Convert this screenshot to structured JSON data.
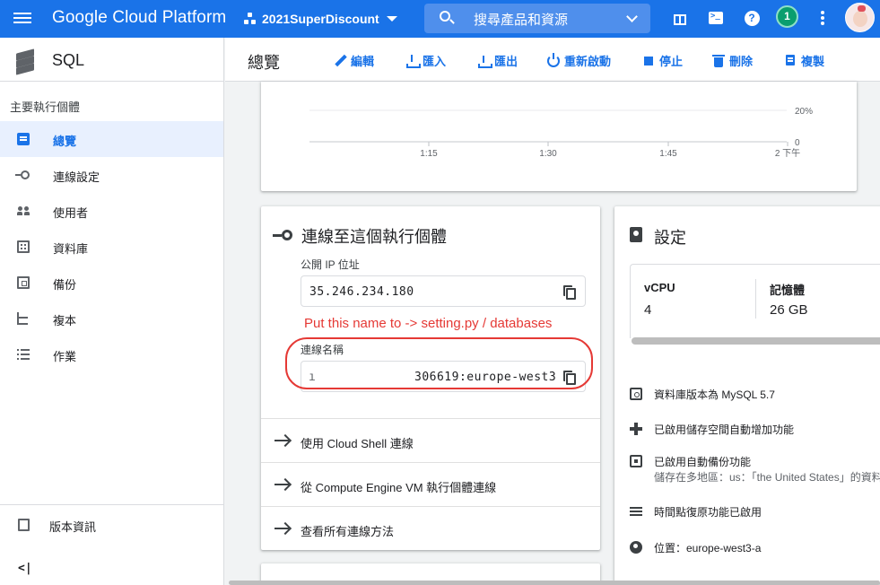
{
  "topbar": {
    "brand": "Google Cloud Platform",
    "project": "2021SuperDiscount",
    "search_placeholder": "搜尋產品和資源",
    "notification_count": "1",
    "icons": [
      "menu-icon",
      "project-icon",
      "search-icon",
      "gift-icon",
      "cloud-shell-icon",
      "help-icon",
      "more-icon",
      "avatar"
    ],
    "accent_color": "#1a73e8"
  },
  "sidebar": {
    "title": "SQL",
    "section": "主要執行個體",
    "items": [
      {
        "label": "總覽",
        "icon": "overview-icon",
        "active": true
      },
      {
        "label": "連線設定",
        "icon": "connection-icon",
        "active": false
      },
      {
        "label": "使用者",
        "icon": "users-icon",
        "active": false
      },
      {
        "label": "資料庫",
        "icon": "database-icon",
        "active": false
      },
      {
        "label": "備份",
        "icon": "backup-icon",
        "active": false
      },
      {
        "label": "複本",
        "icon": "replica-icon",
        "active": false
      },
      {
        "label": "作業",
        "icon": "operations-icon",
        "active": false
      }
    ],
    "release_notes": "版本資訊",
    "collapse": "<|"
  },
  "header": {
    "title": "總覽",
    "actions": [
      "編輯",
      "匯入",
      "匯出",
      "重新啟動",
      "停止",
      "刪除",
      "複製"
    ]
  },
  "chart_data": {
    "type": "line",
    "x_ticks": [
      "1:15",
      "1:30",
      "1:45",
      "2 下午"
    ],
    "y_ticks": [
      "20%",
      "0"
    ],
    "series": [
      {
        "values": [
          0,
          0,
          0,
          0
        ]
      }
    ],
    "grid": true
  },
  "connection": {
    "title": "連線至這個執行個體",
    "public_ip_label": "公開 IP 位址",
    "public_ip": "35.246.234.180",
    "annotation": "Put this name to -> setting.py / databases",
    "connection_name_label": "連線名稱",
    "connection_name": "306619:europe-west3",
    "connection_name_prefix": "ı",
    "methods": [
      "使用 Cloud Shell 連線",
      "從 Compute Engine VM 執行個體連線",
      "查看所有連線方法"
    ]
  },
  "settings": {
    "title": "設定",
    "vcpu_label": "vCPU",
    "vcpu": "4",
    "memory_label": "記憶體",
    "memory": "26 GB",
    "rows": [
      {
        "text": "資料庫版本為 MySQL 5.7",
        "icon": "version-icon"
      },
      {
        "text": "已啟用儲存空間自動增加功能",
        "icon": "auto-storage-icon"
      },
      {
        "text": "已啟用自動備份功能",
        "sub": "儲存在多地區：us：「the United States」的資料",
        "icon": "backup-icon"
      },
      {
        "text": "時間點復原功能已啟用",
        "icon": "pitr-icon"
      },
      {
        "text": "位置：europe-west3-a",
        "icon": "location-icon"
      }
    ]
  }
}
